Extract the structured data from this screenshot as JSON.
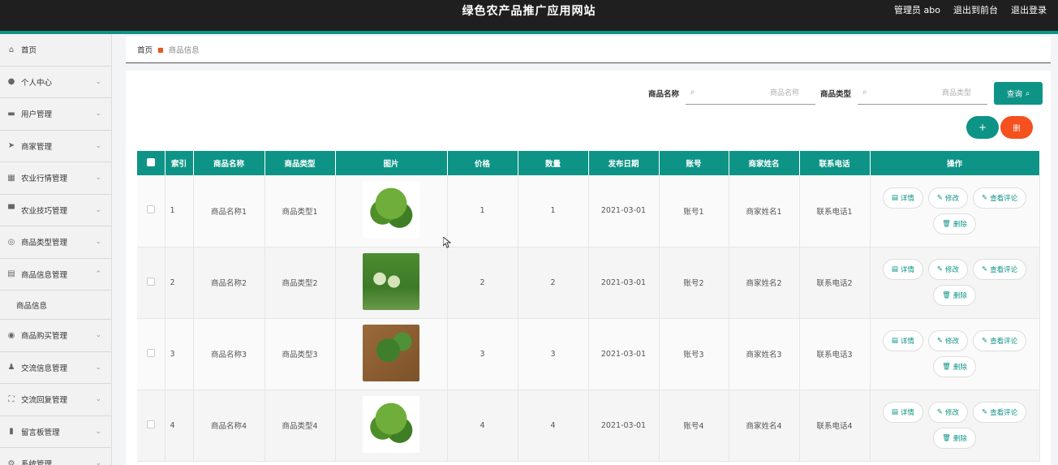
{
  "header": {
    "title": "绿色农产品推广应用网站",
    "admin": "管理员 abo",
    "front": "退出到前台",
    "logout": "退出登录"
  },
  "sidebar": {
    "items": [
      {
        "label": "首页",
        "icon": "home-icon",
        "glyph": "⌂"
      },
      {
        "label": "个人中心",
        "icon": "user-icon",
        "glyph": "●"
      },
      {
        "label": "用户管理",
        "icon": "chat-icon",
        "glyph": "▬"
      },
      {
        "label": "商家管理",
        "icon": "send-icon",
        "glyph": "➤"
      },
      {
        "label": "农业行情管理",
        "icon": "grid-icon",
        "glyph": "▦"
      },
      {
        "label": "农业技巧管理",
        "icon": "monitor-icon",
        "glyph": "▀"
      },
      {
        "label": "商品类型管理",
        "icon": "compass-icon",
        "glyph": "◎"
      },
      {
        "label": "商品信息管理",
        "icon": "doc-icon",
        "glyph": "▤"
      },
      {
        "label": "商品购买管理",
        "icon": "gauge-icon",
        "glyph": "◉"
      },
      {
        "label": "交流信息管理",
        "icon": "person-icon",
        "glyph": "♟"
      },
      {
        "label": "交流回复管理",
        "icon": "frame-icon",
        "glyph": "⛶"
      },
      {
        "label": "留言板管理",
        "icon": "bar-chart-icon",
        "glyph": "▮"
      },
      {
        "label": "系统管理",
        "icon": "settings-icon",
        "glyph": "⚙"
      }
    ],
    "sub_item": "商品信息"
  },
  "breadcrumb": {
    "home": "首页",
    "current": "商品信息"
  },
  "search": {
    "name_label": "商品名称",
    "name_placeholder": "商品名称",
    "type_label": "商品类型",
    "type_placeholder": "商品类型",
    "query_label": "查询"
  },
  "actions": {
    "add": "+",
    "delete": "删"
  },
  "table": {
    "headers": [
      "索引",
      "商品名称",
      "商品类型",
      "图片",
      "价格",
      "数量",
      "发布日期",
      "账号",
      "商家姓名",
      "联系电话",
      "操作"
    ],
    "rows": [
      {
        "idx": "1",
        "name": "商品名称1",
        "type": "商品类型1",
        "img": "broccoli-bowl",
        "price": "1",
        "qty": "1",
        "date": "2021-03-01",
        "account": "账号1",
        "seller": "商家姓名1",
        "phone": "联系电话1"
      },
      {
        "idx": "2",
        "name": "商品名称2",
        "type": "商品类型2",
        "img": "gourd-field",
        "price": "2",
        "qty": "2",
        "date": "2021-03-01",
        "account": "账号2",
        "seller": "商家姓名2",
        "phone": "联系电话2"
      },
      {
        "idx": "3",
        "name": "商品名称3",
        "type": "商品类型3",
        "img": "broccoli-board",
        "price": "3",
        "qty": "3",
        "date": "2021-03-01",
        "account": "账号3",
        "seller": "商家姓名3",
        "phone": "联系电话3"
      },
      {
        "idx": "4",
        "name": "商品名称4",
        "type": "商品类型4",
        "img": "broccoli-bowl",
        "price": "4",
        "qty": "4",
        "date": "2021-03-01",
        "account": "账号4",
        "seller": "商家姓名4",
        "phone": "联系电话4"
      }
    ],
    "ops": {
      "detail": "详情",
      "edit": "修改",
      "review": "查看评论",
      "delete": "删除"
    }
  },
  "colors": {
    "accent": "#0e9486",
    "danger": "#f4511e",
    "topbar": "#1f1f1f"
  }
}
